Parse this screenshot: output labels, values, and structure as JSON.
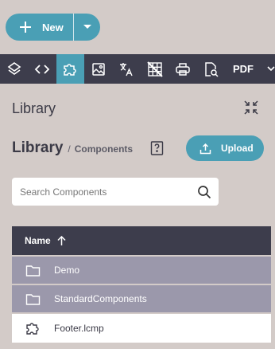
{
  "new_button": {
    "label": "New",
    "plus_icon": "plus-icon",
    "caret_icon": "chevron-down-icon"
  },
  "toolbar": {
    "icons": [
      "layers-icon",
      "code-icon",
      "puzzle-icon",
      "image-icon",
      "translate-icon",
      "grid-off-icon",
      "print-icon",
      "file-search-icon"
    ],
    "active": "puzzle-icon",
    "pdf_label": "PDF"
  },
  "panel": {
    "title": "Library",
    "breadcrumb_main": "Library",
    "breadcrumb_sep": "/",
    "breadcrumb_sub": "Components",
    "upload_label": "Upload"
  },
  "search": {
    "placeholder": "Search Components",
    "value": ""
  },
  "table": {
    "header": "Name",
    "sort": "ascending",
    "rows": [
      {
        "name": "Demo",
        "type": "folder",
        "icon": "folder-icon"
      },
      {
        "name": "StandardComponents",
        "type": "folder",
        "icon": "folder-icon"
      },
      {
        "name": "Footer.lcmp",
        "type": "component",
        "icon": "puzzle-icon"
      }
    ]
  },
  "colors": {
    "accent": "#4a9fb5",
    "toolbar": "#3d3d4c",
    "folder_row": "#9b98ab",
    "background": "#d3cbc8"
  }
}
